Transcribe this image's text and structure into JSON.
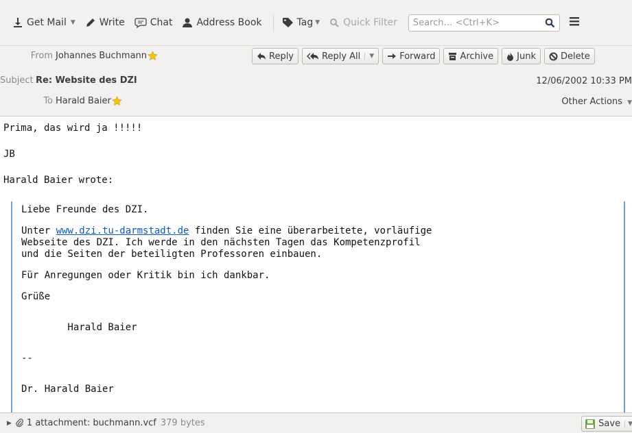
{
  "toolbar": {
    "get_mail": "Get Mail",
    "write": "Write",
    "chat": "Chat",
    "address_book": "Address Book",
    "tag": "Tag",
    "quick_filter": "Quick Filter",
    "search_placeholder": "Search… <Ctrl+K>"
  },
  "header": {
    "from_label": "From",
    "from_value": "Johannes Buchmann",
    "subject_label": "Subject",
    "subject_value": "Re: Website des DZI",
    "to_label": "To",
    "to_value": "Harald Baier",
    "date": "12/06/2002 10:33 PM",
    "other_actions": "Other Actions",
    "actions": {
      "reply": "Reply",
      "reply_all": "Reply All",
      "forward": "Forward",
      "archive": "Archive",
      "junk": "Junk",
      "delete": "Delete"
    }
  },
  "body": {
    "line1": "Prima, das wird ja !!!!!",
    "line2": "JB",
    "line3": "Harald Baier wrote:",
    "quote": {
      "greeting": "Liebe Freunde des DZI.",
      "p1_prefix": "Unter ",
      "p1_link": "www.dzi.tu-darmstadt.de",
      "p1_rest": " finden Sie eine überarbeitete, vorläufige",
      "p1_line2": "Webseite des DZI. Ich werde in den nächsten Tagen das Kompetenzprofil",
      "p1_line3": "und die Seiten der beteiligten Professoren einbauen.",
      "p2": "Für Anregungen oder Kritik bin ich dankbar.",
      "closing": "Grüße",
      "signature_name": "        Harald Baier",
      "sig_sep": "--",
      "sig_full": "Dr. Harald Baier"
    }
  },
  "attachment": {
    "label": "1 attachment: buchmann.vcf",
    "size": "379 bytes",
    "save": "Save"
  },
  "colors": {
    "toolbar_bg": "#f2f1f0",
    "quote_border": "#729fcf",
    "link": "#0b5cc7",
    "star": "#f5c211"
  }
}
